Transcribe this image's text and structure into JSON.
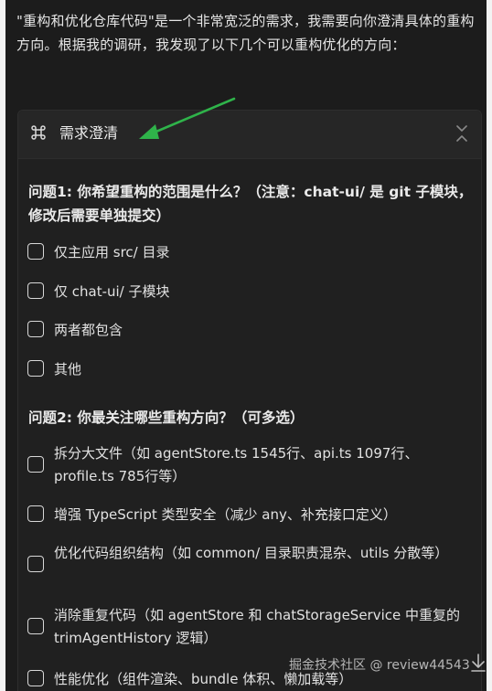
{
  "intro_text": "\"重构和优化仓库代码\"是一个非常宽泛的需求，我需要向你澄清具体的重构方向。根据我的调研，我发现了以下几个可以重构优化的方向：",
  "card": {
    "title": "需求澄清",
    "icon": "command-icon",
    "collapse_icon": "collapse-chevrons-icon"
  },
  "questions": [
    {
      "title": "问题1: 你希望重构的范围是什么？（注意：chat-ui/ 是 git 子模块，修改后需要单独提交）",
      "options": [
        "仅主应用 src/ 目录",
        "仅 chat-ui/ 子模块",
        "两者都包含",
        "其他"
      ]
    },
    {
      "title": "问题2: 你最关注哪些重构方向？（可多选）",
      "options": [
        "拆分大文件（如 agentStore.ts 1545行、api.ts 1097行、profile.ts 785行等）",
        "增强 TypeScript 类型安全（减少 any、补充接口定义）",
        "优化代码组织结构（如 common/ 目录职责混杂、utils 分散等）",
        "消除重复代码（如 agentStore 和 chatStorageService 中重复的 trimAgentHistory 逻辑）",
        "性能优化（组件渲染、bundle 体积、懒加载等）"
      ]
    }
  ],
  "watermark": "掘金技术社区 @ review44543",
  "colors": {
    "panel_bg": "#1c1c1c",
    "card_header_bg": "#262626",
    "arrow": "#2fb34a",
    "text": "#e8e8e8"
  }
}
